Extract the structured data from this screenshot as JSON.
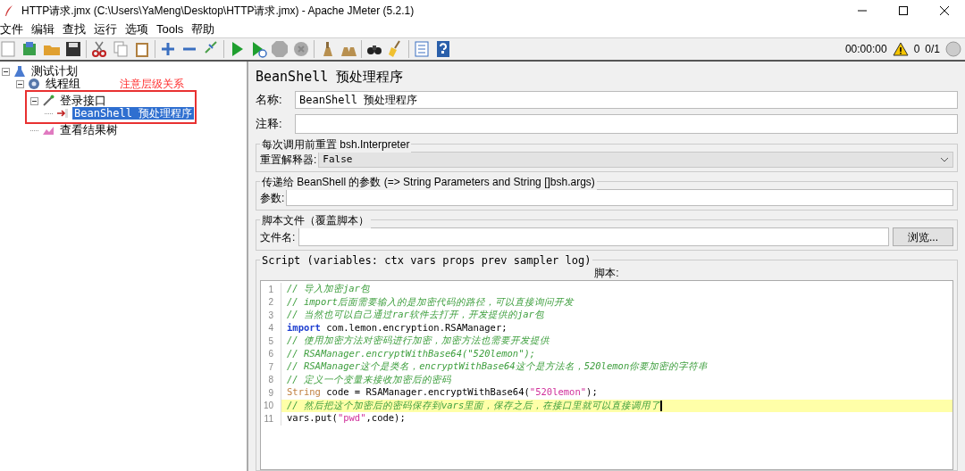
{
  "window": {
    "title": "HTTP请求.jmx (C:\\Users\\YaMeng\\Desktop\\HTTP请求.jmx) - Apache JMeter (5.2.1)"
  },
  "menu": [
    "文件",
    "编辑",
    "查找",
    "运行",
    "选项",
    "Tools",
    "帮助"
  ],
  "status": {
    "time": "00:00:00",
    "warnings": "0",
    "threads": "0/1"
  },
  "tree": [
    {
      "label": "测试计划",
      "kind": "plan",
      "expanded": true,
      "selected": false,
      "children": [
        {
          "label": "线程组",
          "kind": "group",
          "expanded": true,
          "selected": false,
          "note": "注意层级关系",
          "children": [
            {
              "label": "登录接口",
              "kind": "sampler",
              "expanded": true,
              "selected": false,
              "boxed": true,
              "children": [
                {
                  "label": "BeanShell 预处理程序",
                  "kind": "pre",
                  "selected": true
                }
              ]
            },
            {
              "label": "查看结果树",
              "kind": "listener",
              "selected": false
            }
          ]
        }
      ]
    }
  ],
  "panel": {
    "title": "BeanShell 预处理程序",
    "name_label": "名称:",
    "name_value": "BeanShell 预处理程序",
    "comment_label": "注释:",
    "reset_legend": "每次调用前重置 bsh.Interpreter",
    "reset_label": "重置解释器:",
    "reset_value": "False",
    "params_legend": "传递给 BeanShell 的参数 (=> String Parameters and String []bsh.args)",
    "params_label": "参数:",
    "file_legend": "脚本文件（覆盖脚本）",
    "file_label": "文件名:",
    "browse": "浏览...",
    "script_legend": "Script (variables: ctx vars props prev sampler log)",
    "script_label": "脚本:",
    "code": [
      {
        "number": "1",
        "current": false,
        "tokens": [
          {
            "kind": "comment",
            "text": "// 导入加密jar包"
          }
        ]
      },
      {
        "number": "2",
        "current": false,
        "tokens": [
          {
            "kind": "comment",
            "text": "// import后面需要输入的是加密代码的路径，可以直接询问开发"
          }
        ]
      },
      {
        "number": "3",
        "current": false,
        "tokens": [
          {
            "kind": "comment",
            "text": "// 当然也可以自己通过rar软件去打开，开发提供的jar包"
          }
        ]
      },
      {
        "number": "4",
        "current": false,
        "tokens": [
          {
            "kind": "keyword",
            "text": "import"
          },
          {
            "kind": "plain",
            "text": " com.lemon.encryption.RSAManager;"
          }
        ]
      },
      {
        "number": "5",
        "current": false,
        "tokens": [
          {
            "kind": "comment",
            "text": "// 使用加密方法对密码进行加密，加密方法也需要开发提供"
          }
        ]
      },
      {
        "number": "6",
        "current": false,
        "tokens": [
          {
            "kind": "comment",
            "text": "// RSAManager.encryptWithBase64(\"520lemon\");"
          }
        ]
      },
      {
        "number": "7",
        "current": false,
        "tokens": [
          {
            "kind": "comment",
            "text": "// RSAManager这个是类名，encryptWithBase64这个是方法名，520lemon你要加密的字符串"
          }
        ]
      },
      {
        "number": "8",
        "current": false,
        "tokens": [
          {
            "kind": "comment",
            "text": "// 定义一个变量来接收加密后的密码"
          }
        ]
      },
      {
        "number": "9",
        "current": false,
        "tokens": [
          {
            "kind": "type",
            "text": "String"
          },
          {
            "kind": "plain",
            "text": " code = RSAManager.encryptWithBase64("
          },
          {
            "kind": "string",
            "text": "\"520lemon\""
          },
          {
            "kind": "plain",
            "text": ");"
          }
        ]
      },
      {
        "number": "10",
        "current": true,
        "tokens": [
          {
            "kind": "comment",
            "text": "// 然后把这个加密后的密码保存到vars里面，保存之后，在接口里就可以直接调用了"
          }
        ]
      },
      {
        "number": "11",
        "current": false,
        "tokens": [
          {
            "kind": "plain",
            "text": "vars.put("
          },
          {
            "kind": "string",
            "text": "\"pwd\""
          },
          {
            "kind": "plain",
            "text": ",code);"
          }
        ]
      }
    ]
  }
}
